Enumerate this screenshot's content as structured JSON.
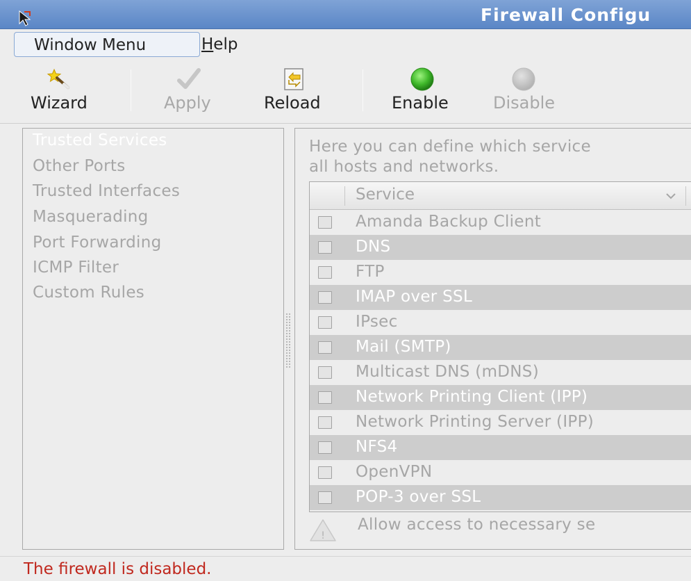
{
  "window": {
    "title": "Firewall Configu"
  },
  "menubar": {
    "items": [
      {
        "label": "Window Menu"
      },
      {
        "label_mnemonic": "H",
        "label_rest": "elp"
      }
    ]
  },
  "toolbar": {
    "buttons": [
      {
        "label": "Wizard",
        "icon": "wizard-wand-icon",
        "enabled": true
      },
      {
        "label": "Apply",
        "icon": "checkmark-icon",
        "enabled": false
      },
      {
        "label": "Reload",
        "icon": "reload-icon",
        "enabled": true
      },
      {
        "label": "Enable",
        "icon": "green-light-icon",
        "enabled": true
      },
      {
        "label": "Disable",
        "icon": "gray-light-icon",
        "enabled": false
      }
    ]
  },
  "sidebar": {
    "items": [
      {
        "label": "Trusted Services",
        "selected": true
      },
      {
        "label": "Other Ports"
      },
      {
        "label": "Trusted Interfaces"
      },
      {
        "label": "Masquerading"
      },
      {
        "label": "Port Forwarding"
      },
      {
        "label": "ICMP Filter"
      },
      {
        "label": "Custom Rules"
      }
    ]
  },
  "main": {
    "description_line1": "Here you can define which service",
    "description_line2": "all hosts and networks.",
    "table": {
      "column_header": "Service",
      "rows": [
        {
          "label": "Amanda Backup Client",
          "checked": false
        },
        {
          "label": "DNS",
          "checked": false
        },
        {
          "label": "FTP",
          "checked": false
        },
        {
          "label": "IMAP over SSL",
          "checked": false
        },
        {
          "label": "IPsec",
          "checked": false
        },
        {
          "label": "Mail (SMTP)",
          "checked": false
        },
        {
          "label": "Multicast DNS (mDNS)",
          "checked": false
        },
        {
          "label": "Network Printing Client (IPP)",
          "checked": false
        },
        {
          "label": "Network Printing Server (IPP)",
          "checked": false
        },
        {
          "label": "NFS4",
          "checked": false
        },
        {
          "label": "OpenVPN",
          "checked": false
        },
        {
          "label": "POP-3 over SSL",
          "checked": false
        }
      ]
    },
    "warning": "Allow access to necessary se"
  },
  "statusbar": {
    "text": "The firewall is disabled."
  },
  "colors": {
    "titlebar": "#5a86c6",
    "status_error": "#c0281e",
    "enable_green": "#3fb82a",
    "disabled_text": "#a6a6a6"
  }
}
